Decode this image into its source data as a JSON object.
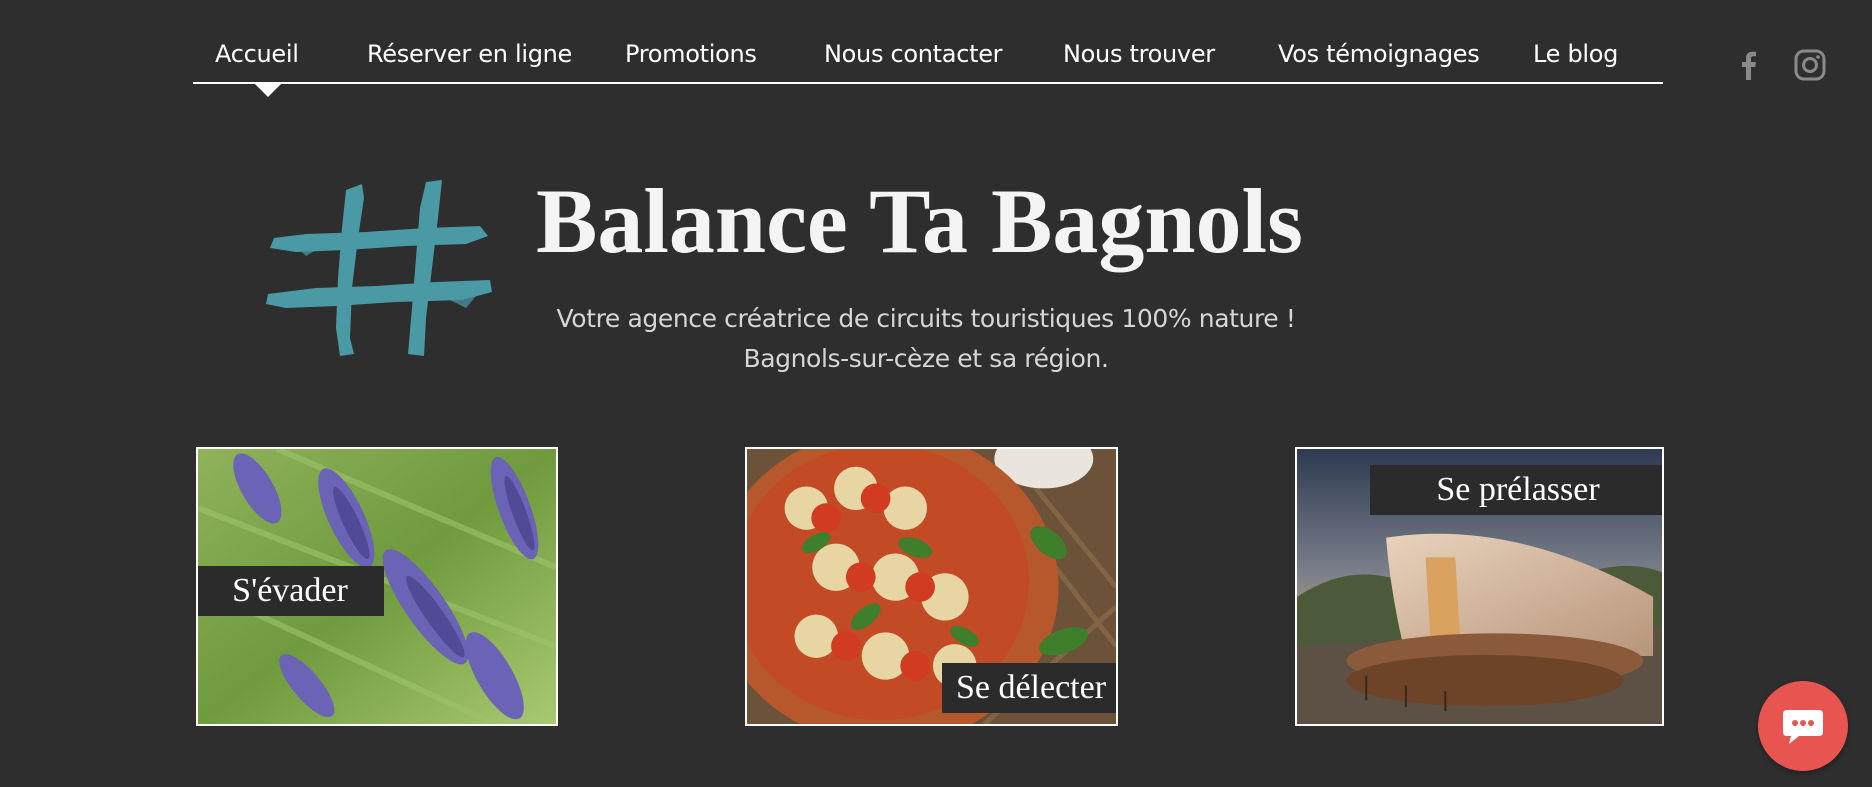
{
  "nav": {
    "items": [
      {
        "label": "Accueil",
        "active": true
      },
      {
        "label": "Réserver en ligne"
      },
      {
        "label": "Promotions"
      },
      {
        "label": "Nous contacter"
      },
      {
        "label": "Nous trouver"
      },
      {
        "label": "Vos témoignages"
      },
      {
        "label": "Le blog"
      }
    ]
  },
  "social": [
    {
      "icon": "facebook-icon"
    },
    {
      "icon": "instagram-icon"
    }
  ],
  "hero": {
    "title": "Balance Ta Bagnols",
    "tagline_line1": "Votre agence créatrice de circuits touristiques 100% nature !",
    "tagline_line2": "Bagnols-sur-cèze et sa région.",
    "logo_color": "#4a9aa6"
  },
  "cards": [
    {
      "label": "S'évader",
      "image": "lavender field"
    },
    {
      "label": "Se délecter",
      "image": "ratatouille dish"
    },
    {
      "label": "Se prélasser",
      "image": "glamping dome tent"
    }
  ],
  "chat": {
    "icon": "chat-bubble-icon",
    "color": "#e8544f"
  }
}
